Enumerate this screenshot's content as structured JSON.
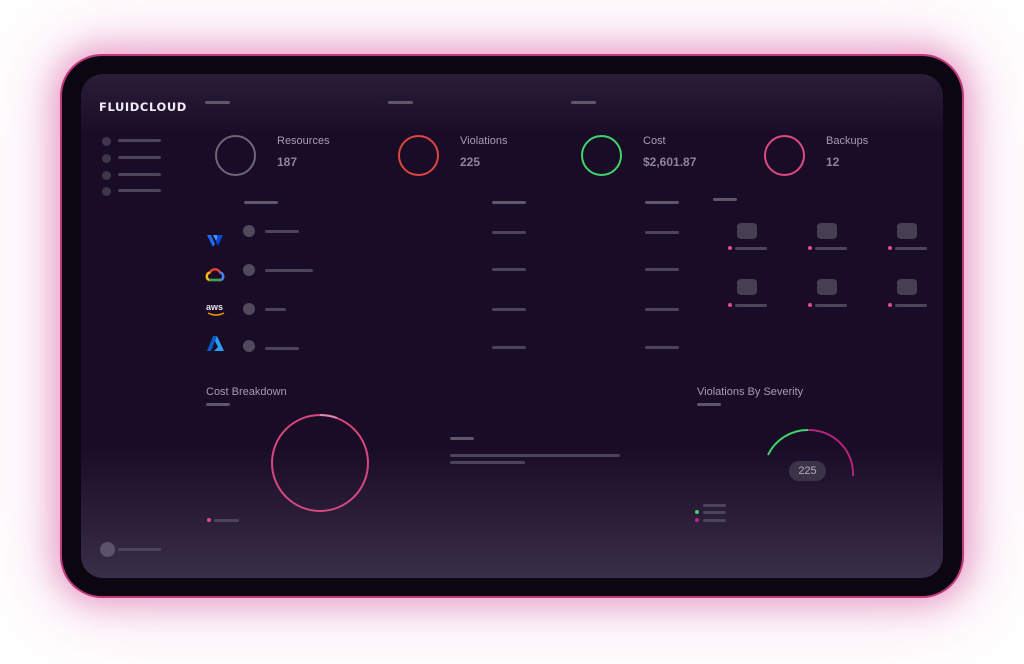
{
  "app": {
    "logo": "FLUIDCLOUD"
  },
  "stats": [
    {
      "label": "Resources",
      "value": "187",
      "ring_color": "#6e6677"
    },
    {
      "label": "Violations",
      "value": "225",
      "ring_color": "#e0443e"
    },
    {
      "label": "Cost",
      "value": "$2,601.87",
      "ring_color": "#3ed46a"
    },
    {
      "label": "Backups",
      "value": "12",
      "ring_color": "#e0497f"
    }
  ],
  "providers": [
    {
      "icon": "vultr-logo-icon",
      "color": "#1e6bff"
    },
    {
      "icon": "google-cloud-logo-icon",
      "color": "#fbbc05"
    },
    {
      "icon": "aws-logo-icon",
      "color": "#ff9900",
      "text": "aws"
    },
    {
      "icon": "azure-logo-icon",
      "color": "#1f8cf0"
    }
  ],
  "cost_breakdown": {
    "title": "Cost Breakdown",
    "ring_color": "#d9467f"
  },
  "violations_by_severity": {
    "title": "Violations By Severity",
    "total": "225",
    "legend_colors": [
      "#3ed46a",
      "#c0237e"
    ]
  },
  "colors": {
    "accent": "#e04a8c",
    "screen_bg": "#190c26",
    "device_glow": "#c2387f"
  }
}
